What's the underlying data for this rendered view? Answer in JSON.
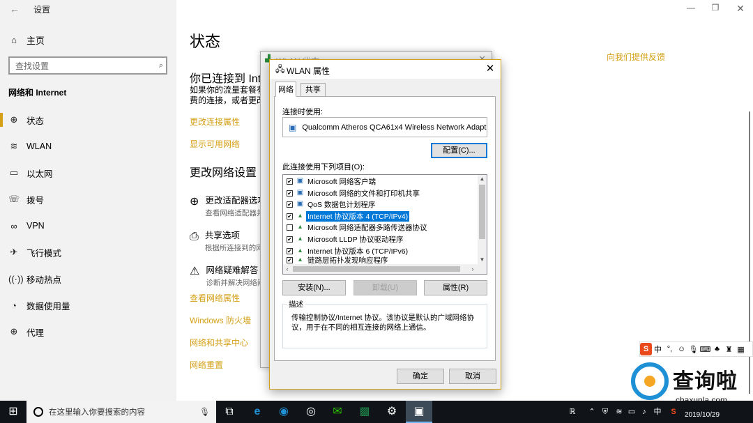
{
  "settings": {
    "window_title": "设置",
    "back_icon": "back-arrow-icon",
    "home_label": "主页",
    "search_placeholder": "查找设置",
    "section_title": "网络和 Internet",
    "nav_items": [
      {
        "label": "状态",
        "icon": "status-globe-icon"
      },
      {
        "label": "WLAN",
        "icon": "wlan-icon"
      },
      {
        "label": "以太网",
        "icon": "ethernet-icon"
      },
      {
        "label": "拨号",
        "icon": "dialup-icon"
      },
      {
        "label": "VPN",
        "icon": "vpn-icon"
      },
      {
        "label": "飞行模式",
        "icon": "airplane-icon"
      },
      {
        "label": "移动热点",
        "icon": "hotspot-icon"
      },
      {
        "label": "数据使用量",
        "icon": "data-usage-icon"
      },
      {
        "label": "代理",
        "icon": "proxy-globe-icon"
      }
    ],
    "page_title": "状态",
    "feedback_link": "向我们提供反馈",
    "connected_heading": "你已连接到 Internet",
    "connected_text_1": "如果你的流量套餐有限制，则你可以将此网络设置为按流量计",
    "connected_text_2": "费的连接，或者更改其他属性。",
    "link_change_props": "更改连接属性",
    "link_show_networks": "显示可用网络",
    "change_heading": "更改网络设置",
    "options": [
      {
        "title": "更改适配器选项",
        "sub": "查看网络适配器并更改连接设置。"
      },
      {
        "title": "共享选项",
        "sub": "根据所连接到的网络，决定要共享的内容。"
      },
      {
        "title": "网络疑难解答",
        "sub": "诊断并解决网络问题。"
      }
    ],
    "link_view_props": "查看网络属性",
    "link_firewall": "Windows 防火墙",
    "link_sharing_center": "网络和共享中心",
    "link_reset": "网络重置"
  },
  "status_window": {
    "title": "WLAN 状态"
  },
  "dialog": {
    "title": "WLAN 属性",
    "tab_network": "网络",
    "tab_sharing": "共享",
    "connect_using_label": "连接时使用:",
    "adapter_name": "Qualcomm Atheros QCA61x4 Wireless Network Adapter",
    "configure_btn": "配置(C)...",
    "items_label": "此连接使用下列项目(O):",
    "items": [
      {
        "label": "Microsoft 网络客户端",
        "checked": true,
        "selected": false
      },
      {
        "label": "Microsoft 网络的文件和打印机共享",
        "checked": true,
        "selected": false
      },
      {
        "label": "QoS 数据包计划程序",
        "checked": true,
        "selected": false
      },
      {
        "label": "Internet 协议版本 4 (TCP/IPv4)",
        "checked": true,
        "selected": true
      },
      {
        "label": "Microsoft 网络适配器多路传送器协议",
        "checked": false,
        "selected": false
      },
      {
        "label": "Microsoft LLDP 协议驱动程序",
        "checked": true,
        "selected": false
      },
      {
        "label": "Internet 协议版本 6 (TCP/IPv6)",
        "checked": true,
        "selected": false
      },
      {
        "label": "链路层拓扑发现响应程序",
        "checked": true,
        "selected": false
      }
    ],
    "install_btn": "安装(N)...",
    "uninstall_btn": "卸载(U)",
    "properties_btn": "属性(R)",
    "description_legend": "描述",
    "description_text": "传输控制协议/Internet 协议。该协议是默认的广域网络协议，用于在不同的相互连接的网络上通信。",
    "ok_btn": "确定",
    "cancel_btn": "取消"
  },
  "ime": {
    "logo": "S",
    "mode": "中",
    "punct": "°,"
  },
  "watermark": {
    "title": "查询啦",
    "url": "chaxunla.com"
  },
  "taskbar": {
    "search_placeholder": "在这里输入你要搜索的内容",
    "lang_indicator": "中",
    "date": "2019/10/29"
  }
}
